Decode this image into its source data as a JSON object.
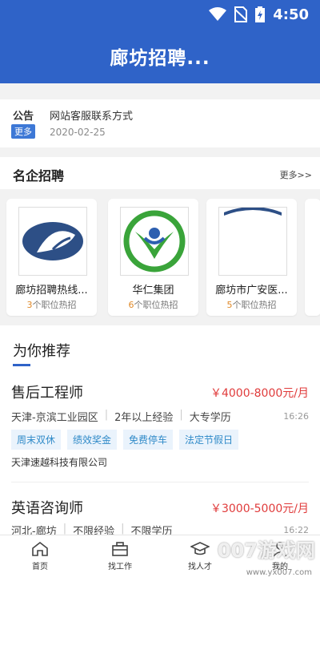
{
  "status": {
    "time": "4:50"
  },
  "header": {
    "title": "廊坊招聘..."
  },
  "notice": {
    "label": "公告",
    "more": "更多",
    "text": "网站客服联系方式",
    "date": "2020-02-25"
  },
  "companies_section": {
    "title": "名企招聘",
    "more": "更多>>"
  },
  "companies": [
    {
      "name": "廊坊招聘热线...",
      "count": "3",
      "suffix": "个职位热招"
    },
    {
      "name": "华仁集团",
      "count": "6",
      "suffix": "个职位热招"
    },
    {
      "name": "廊坊市广安医...",
      "count": "5",
      "suffix": "个职位热招"
    }
  ],
  "recommend": {
    "title": "为你推荐",
    "jobs": [
      {
        "title": "售后工程师",
        "salary": "￥4000-8000元/月",
        "location": "天津-京滨工业园区",
        "experience": "2年以上经验",
        "education": "大专学历",
        "time": "16:26",
        "tags": [
          "周末双休",
          "绩效奖金",
          "免费停车",
          "法定节假日"
        ],
        "company": "天津速越科技有限公司"
      },
      {
        "title": "英语咨询师",
        "salary": "￥3000-5000元/月",
        "location": "河北-廊坊",
        "experience": "不限经验",
        "education": "不限学历",
        "time": "16:22"
      }
    ]
  },
  "tabs": [
    {
      "label": "首页",
      "icon": "home-icon"
    },
    {
      "label": "找工作",
      "icon": "briefcase-icon"
    },
    {
      "label": "找人才",
      "icon": "graduation-cap-icon"
    },
    {
      "label": "我的",
      "icon": "user-icon"
    }
  ],
  "watermark": {
    "main": "007游戏网",
    "sub": "www.yx007.com"
  },
  "colors": {
    "primary": "#2f63c8",
    "salary": "#e03b3b",
    "tag_text": "#2f8ac8",
    "count": "#e08a2a"
  }
}
